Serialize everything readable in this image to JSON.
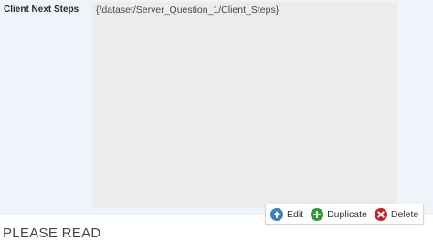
{
  "field": {
    "label": "Client Next Steps",
    "value": "{/dataset/Server_Question_1/Client_Steps}"
  },
  "toolbar": {
    "edit": {
      "label": "Edit",
      "icon": "arrow-up-circle-icon",
      "color": "#3a7ec6"
    },
    "duplicate": {
      "label": "Duplicate",
      "icon": "plus-circle-icon",
      "color": "#2e9b2e"
    },
    "delete": {
      "label": "Delete",
      "icon": "x-circle-icon",
      "color": "#c21f1f"
    }
  },
  "next_section": {
    "title": "PLEASE READ"
  }
}
